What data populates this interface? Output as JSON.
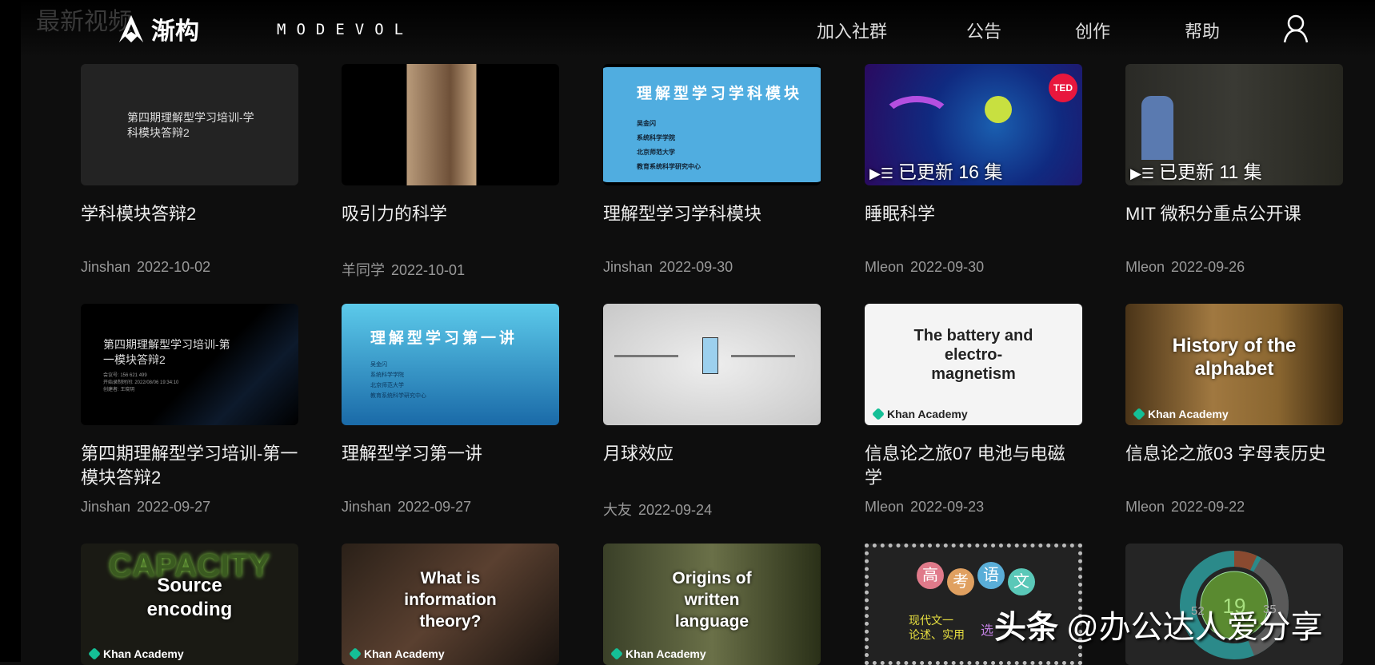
{
  "ghost_heading": "最新视频",
  "header": {
    "logo_text": "渐构",
    "brand": "MODEVOL",
    "nav": [
      "加入社群",
      "公告",
      "创作",
      "帮助"
    ]
  },
  "cards": [
    {
      "title": "学科模块答辩2",
      "author": "Jinshan",
      "date": "2022-10-02",
      "thumb_text": "第四期理解型学习培训-学科模块答辩2"
    },
    {
      "title": "吸引力的科学",
      "author": "羊同学",
      "date": "2022-10-01"
    },
    {
      "title": "理解型学习学科模块",
      "author": "Jinshan",
      "date": "2022-09-30",
      "thumb_text": "理解型学习学科模块",
      "thumb_lines": [
        "吴金闪",
        "系统科学学院",
        "北京师范大学",
        "教育系统科学研究中心"
      ]
    },
    {
      "title": "睡眠科学",
      "author": "Mleon",
      "date": "2022-09-30",
      "badge": "TED",
      "episodes": "已更新 16 集"
    },
    {
      "title": "MIT 微积分重点公开课",
      "author": "Mleon",
      "date": "2022-09-26",
      "episodes": "已更新 11 集"
    },
    {
      "title": "第四期理解型学习培训-第一模块答辩2",
      "author": "Jinshan",
      "date": "2022-09-27",
      "thumb_text": "第四期理解型学习培训-第一模块答辩2",
      "thumb_lines": [
        "会议号: 156 621 499",
        "开始录制时间: 2022/08/06 19:34:10",
        "创建者: 王晓玥"
      ]
    },
    {
      "title": "理解型学习第一讲",
      "author": "Jinshan",
      "date": "2022-09-27",
      "thumb_text": "理解型学习第一讲",
      "thumb_lines": [
        "吴金闪",
        "系统科学学院",
        "北京师范大学",
        "教育系统科学研究中心"
      ]
    },
    {
      "title": "月球效应",
      "author": "大友",
      "date": "2022-09-24"
    },
    {
      "title": "信息论之旅07 电池与电磁学",
      "author": "Mleon",
      "date": "2022-09-23",
      "thumb_text": "The battery and electro-magnetism",
      "brand": "Khan Academy"
    },
    {
      "title": "信息论之旅03 字母表历史",
      "author": "Mleon",
      "date": "2022-09-22",
      "thumb_text": "History of the alphabet",
      "brand": "Khan Academy"
    },
    {
      "thumb_text": "Source encoding",
      "thumb_sub": "CAPACITY",
      "brand": "Khan Academy"
    },
    {
      "thumb_text": "What is information theory?",
      "brand": "Khan Academy"
    },
    {
      "thumb_text": "Origins of written language",
      "brand": "Khan Academy"
    },
    {
      "thumb_chars": [
        "高",
        "考",
        "语",
        "文"
      ],
      "thumb_lines": [
        "现代文一",
        "论述、实用",
        "选"
      ]
    },
    {
      "donut": [
        "19",
        "52",
        "35"
      ]
    }
  ],
  "watermark": {
    "platform": "头条",
    "handle": "@办公达人爱分享"
  }
}
